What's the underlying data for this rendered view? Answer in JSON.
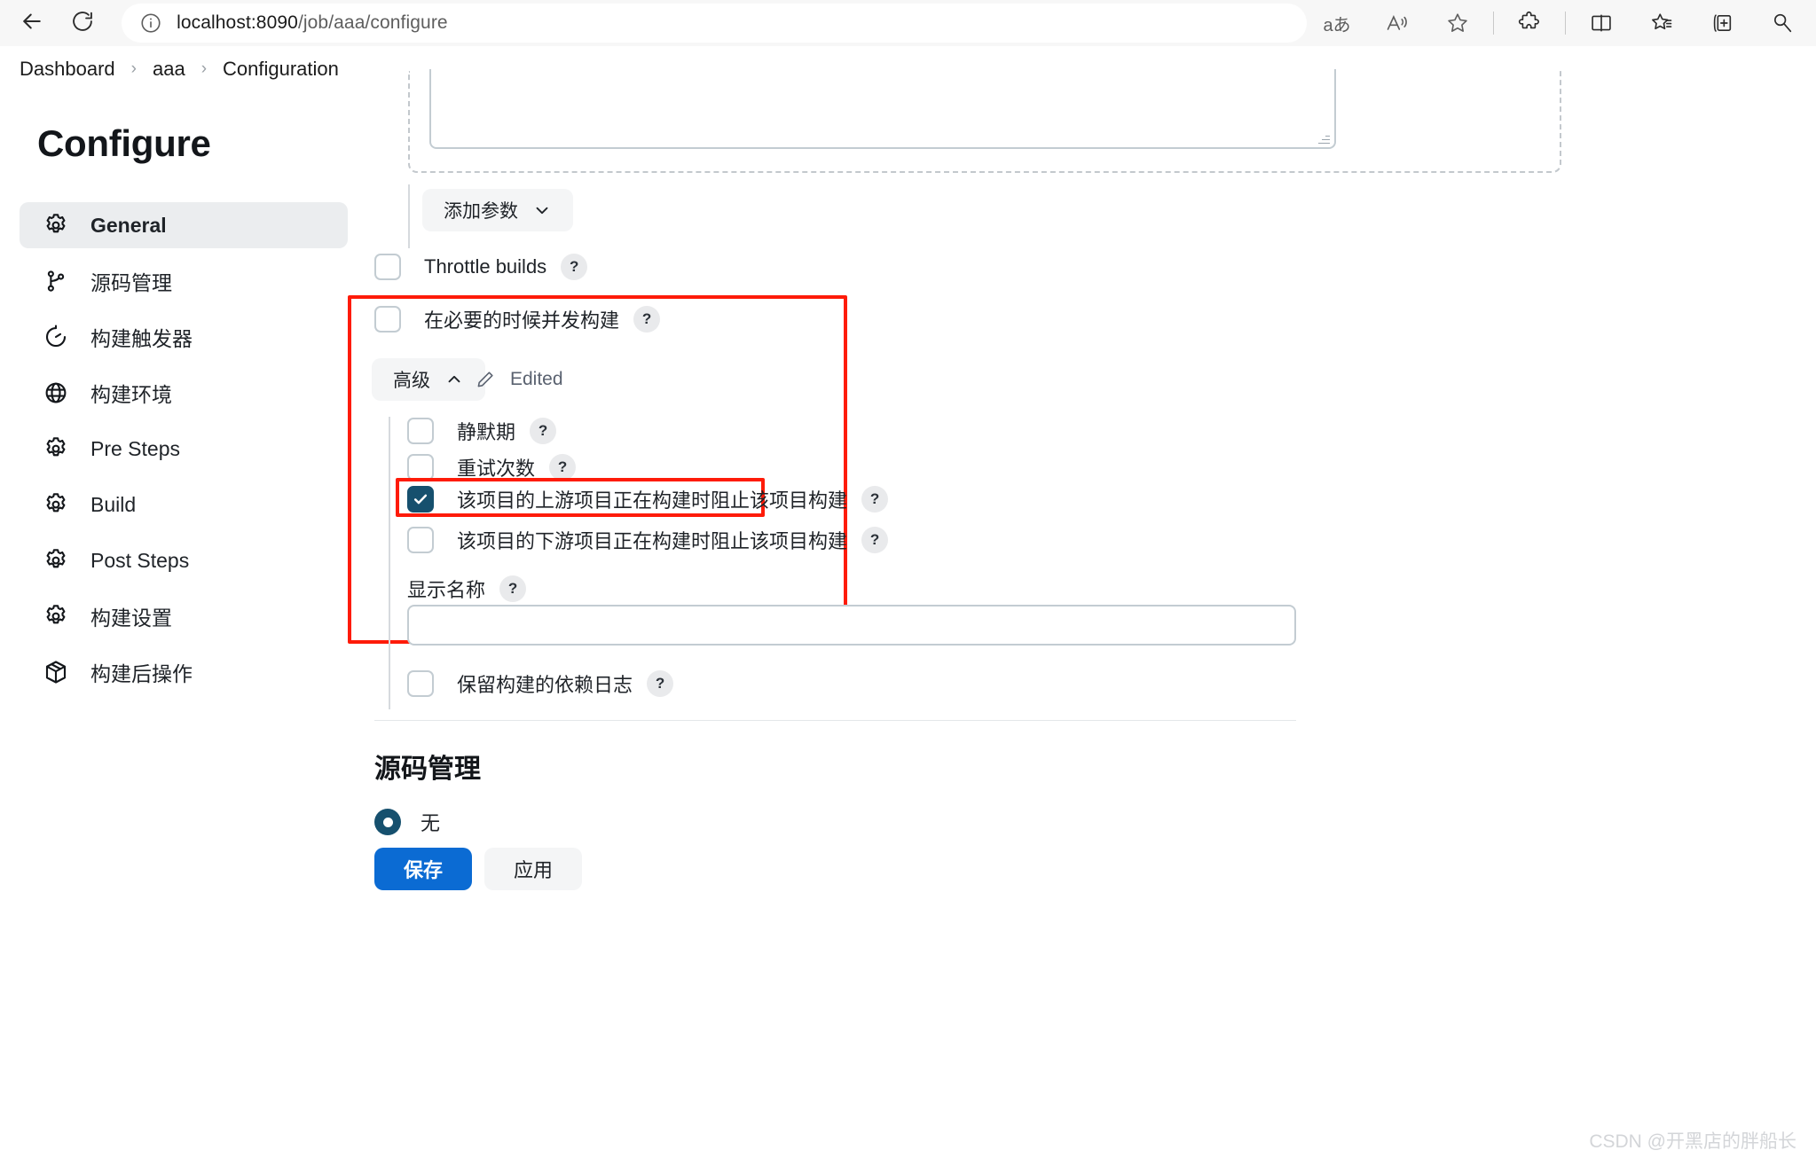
{
  "browser": {
    "back_icon": "back-arrow-icon",
    "reload_icon": "reload-icon",
    "info_icon": "info-circle-icon",
    "url_host": "localhost:8090",
    "url_path": "/job/aaa/configure",
    "toolbar_icons": [
      {
        "name": "translate-icon",
        "glyph": "aあ"
      },
      {
        "name": "read-aloud-icon",
        "glyph": "A"
      },
      {
        "name": "favorite-star-icon",
        "glyph": "☆"
      },
      {
        "name": "extensions-puzzle-icon",
        "glyph": "puzzle"
      },
      {
        "name": "split-screen-icon",
        "glyph": "split"
      },
      {
        "name": "favorites-list-icon",
        "glyph": "star-list"
      },
      {
        "name": "collections-icon",
        "glyph": "collection-plus"
      },
      {
        "name": "browser-essentials-icon",
        "glyph": "essentials"
      }
    ]
  },
  "breadcrumb": {
    "items": [
      "Dashboard",
      "aaa",
      "Configuration"
    ],
    "separator": "›"
  },
  "sidebar": {
    "title": "Configure",
    "items": [
      {
        "label": "General",
        "icon": "gear-icon",
        "active": true
      },
      {
        "label": "源码管理",
        "icon": "source-branch-icon",
        "active": false
      },
      {
        "label": "构建触发器",
        "icon": "clock-icon",
        "active": false
      },
      {
        "label": "构建环境",
        "icon": "globe-icon",
        "active": false
      },
      {
        "label": "Pre Steps",
        "icon": "gear-icon",
        "active": false
      },
      {
        "label": "Build",
        "icon": "gear-icon",
        "active": false
      },
      {
        "label": "Post Steps",
        "icon": "gear-icon",
        "active": false
      },
      {
        "label": "构建设置",
        "icon": "gear-icon",
        "active": false
      },
      {
        "label": "构建后操作",
        "icon": "package-icon",
        "active": false
      }
    ]
  },
  "main": {
    "add_parameter_button": "添加参数",
    "throttle_builds": {
      "label": "Throttle builds",
      "help": "?",
      "checked": false
    },
    "concurrent_build": {
      "label": "在必要的时候并发构建",
      "help": "?",
      "checked": false
    },
    "advanced_button": "高级",
    "edited_label": "Edited",
    "advanced_options": [
      {
        "label": "静默期",
        "help": "?",
        "checked": false,
        "highlighted": false
      },
      {
        "label": "重试次数",
        "help": "?",
        "checked": false,
        "highlighted": false
      },
      {
        "label": "该项目的上游项目正在构建时阻止该项目构建",
        "help": "?",
        "checked": true,
        "highlighted": true
      },
      {
        "label": "该项目的下游项目正在构建时阻止该项目构建",
        "help": "?",
        "checked": false,
        "highlighted": false
      }
    ],
    "display_name": {
      "label": "显示名称",
      "help": "?",
      "value": "",
      "placeholder": ""
    },
    "keep_dependency_log": {
      "label": "保留构建的依赖日志",
      "help": "?",
      "checked": false
    },
    "scm_section": {
      "heading": "源码管理",
      "options": [
        {
          "label": "无",
          "selected": true
        }
      ]
    },
    "footer": {
      "save_label": "保存",
      "apply_label": "应用"
    }
  },
  "watermark": "CSDN @开黑店的胖船长",
  "colors": {
    "accent_blue": "#0b6bd3",
    "checkbox_checked": "#16506e",
    "highlight_red": "#fe1b09",
    "sidebar_active_bg": "#ebedef"
  }
}
